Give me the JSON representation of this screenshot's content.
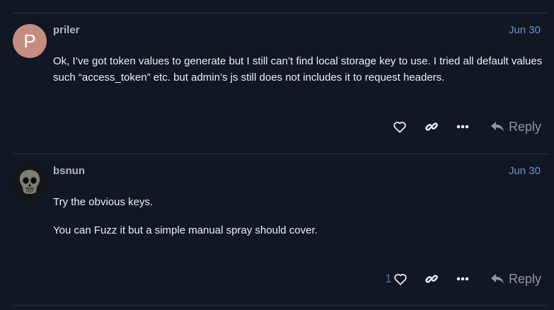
{
  "posts": [
    {
      "username": "priler",
      "avatar_letter": "P",
      "date": "Jun 30",
      "paragraphs": [
        "Ok, I’ve got token values to generate but I still can’t find local storage key to use. I tried all default values such “access_token” etc. but admin’s js still does not includes it to request headers."
      ],
      "likes": "",
      "reply_label": "Reply",
      "avatar_color": "#c58d80"
    },
    {
      "username": "bsnun",
      "avatar_letter": "",
      "date": "Jun 30",
      "paragraphs": [
        "Try the obvious keys.",
        "You can Fuzz it but a simple manual spray should cover."
      ],
      "likes": "1",
      "reply_label": "Reply"
    }
  ],
  "colors": {
    "background": "#111723",
    "divider": "#2a313d",
    "date": "#6b93c9",
    "like_count": "#4a6ea9"
  }
}
